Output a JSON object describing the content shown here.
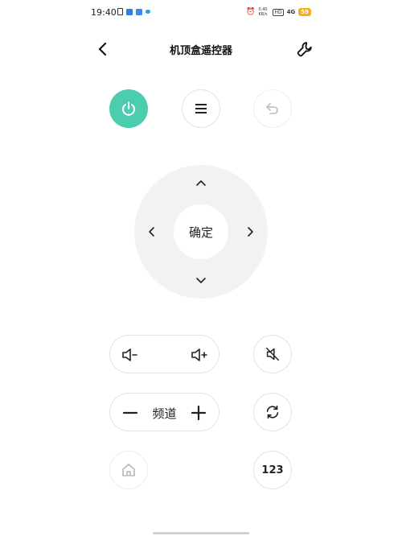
{
  "status_bar": {
    "time": "19:40",
    "net_speed": "0.40 KB/s",
    "hd": "HD",
    "network": "4G",
    "battery": "59"
  },
  "header": {
    "title": "机顶盒遥控器"
  },
  "dpad": {
    "ok_label": "确定"
  },
  "channel": {
    "label": "频道"
  },
  "numpad": {
    "label": "123"
  },
  "colors": {
    "power_accent": "#4dcdb0",
    "dpad_bg": "#f2f2f2",
    "border": "#e3e3e3"
  }
}
